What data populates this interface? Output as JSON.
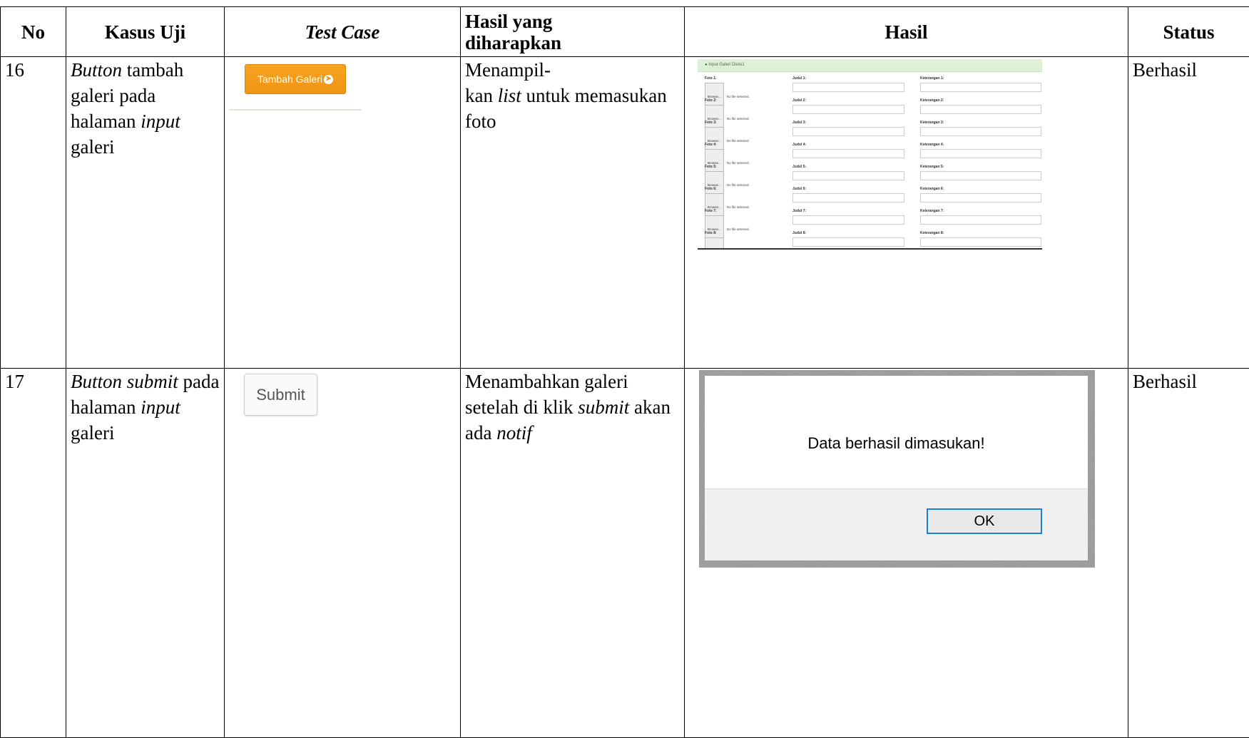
{
  "headers": {
    "no": "No",
    "kasus_uji": "Kasus Uji",
    "test_case": "Test Case",
    "hasil_diharapkan_line1": "Hasil yang",
    "hasil_diharapkan_line2": "diharapkan",
    "hasil": "Hasil",
    "status": "Status"
  },
  "rows": [
    {
      "no": "16",
      "kasus": {
        "it1": "Button",
        "t1": " tambah galeri pada halaman ",
        "it2": "input",
        "t2": " galeri"
      },
      "test_case_button": "Tambah Galeri",
      "expected": {
        "t1": "Menampil-",
        "t2": "kan ",
        "it1": "list",
        "t3": " untuk memasukan foto"
      },
      "status": "Berhasil",
      "gallery": {
        "header": "Input Galeri Divisi1",
        "browse_label": "Browse...",
        "no_file": "No file selected.",
        "items": [
          {
            "foto": "Foto 1:",
            "judul": "Judul 1:",
            "ket": "Keterangan 1:"
          },
          {
            "foto": "Foto 2:",
            "judul": "Judul 2:",
            "ket": "Keterangan 2:"
          },
          {
            "foto": "Foto 3:",
            "judul": "Judul 3:",
            "ket": "Keterangan 3:"
          },
          {
            "foto": "Foto 4:",
            "judul": "Judul 4:",
            "ket": "Keterangan 4:"
          },
          {
            "foto": "Foto 5:",
            "judul": "Judul 5:",
            "ket": "Keterangan 5:"
          },
          {
            "foto": "Foto 6:",
            "judul": "Judul 6:",
            "ket": "Keterangan 6:"
          },
          {
            "foto": "Foto 7:",
            "judul": "Judul 7:",
            "ket": "Keterangan 7:"
          },
          {
            "foto": "Foto 8:",
            "judul": "Judul 8:",
            "ket": "Keterangan 8:"
          }
        ]
      }
    },
    {
      "no": "17",
      "kasus": {
        "it1": "Button submit",
        "t1": " pada halaman ",
        "it2": "input",
        "t2": " galeri"
      },
      "test_case_button": "Submit",
      "expected": {
        "t1": "Menambahkan galeri setelah di klik ",
        "it1": "submit",
        "t2": " akan ada ",
        "it2": "notif"
      },
      "status": "Berhasil",
      "dialog": {
        "message": "Data berhasil dimasukan!",
        "ok": "OK"
      }
    }
  ]
}
